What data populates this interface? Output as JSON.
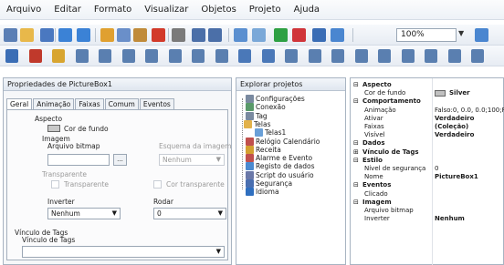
{
  "menu": [
    "Arquivo",
    "Editar",
    "Formato",
    "Visualizar",
    "Objetos",
    "Projeto",
    "Ajuda"
  ],
  "toolbar": {
    "zoom_value": "100%"
  },
  "properties_panel": {
    "title": "Propriedades de PictureBox1",
    "tabs": [
      "Geral",
      "Animação",
      "Faixas",
      "Comum",
      "Eventos"
    ],
    "aspect_label": "Aspecto",
    "bg_color_label": "Cor de fundo",
    "image_label": "Imagem",
    "bitmap_file_label": "Arquivo bitmap",
    "bitmap_browse": "...",
    "image_scheme_label": "Esquema da imagem",
    "image_scheme_value": "Nenhum",
    "transparent_label": "Transparente",
    "transparent_check_label": "Transparente",
    "transparent_color_label": "Cor transparente",
    "invert_label": "Inverter",
    "invert_value": "Nenhum",
    "rotate_label": "Rodar",
    "rotate_value": "0",
    "tag_link_group": "Vínculo de Tags",
    "tag_link_label": "Vínculo de Tags"
  },
  "project_explorer": {
    "title": "Explorar projetos",
    "items": [
      "Configurações",
      "Conexão",
      "Tag",
      "Telas",
      "Telas1",
      "Relógio Calendário",
      "Receita",
      "Alarme e Evento",
      "Registo de dados",
      "Script do usuário",
      "Segurança",
      "Idioma"
    ]
  },
  "property_grid": {
    "rows": [
      {
        "kind": "cat",
        "sign": "⊟",
        "key": "Aspecto"
      },
      {
        "kind": "prop",
        "key": "Cor de fundo",
        "value": "Silver",
        "bold": true,
        "swatch": "#c0c0c0"
      },
      {
        "kind": "cat",
        "sign": "⊟",
        "key": "Comportamento"
      },
      {
        "kind": "prop",
        "key": "Animação",
        "value": "Falso:0, 0.0, 0.0;100;Fals",
        "bold": false
      },
      {
        "kind": "prop",
        "key": "Ativar",
        "value": "Verdadeiro",
        "bold": true
      },
      {
        "kind": "prop",
        "key": "Faixas",
        "value": "(Coleção)",
        "bold": true
      },
      {
        "kind": "prop",
        "key": "Visível",
        "value": "Verdadeiro",
        "bold": true
      },
      {
        "kind": "cat",
        "sign": "⊟",
        "key": "Dados"
      },
      {
        "kind": "cat",
        "sign": "⊞",
        "key": "Vínculo de Tags"
      },
      {
        "kind": "cat",
        "sign": "⊟",
        "key": "Estilo"
      },
      {
        "kind": "prop",
        "key": "Nível de segurança",
        "value": "0",
        "bold": false
      },
      {
        "kind": "prop",
        "key": "Nome",
        "value": "PictureBox1",
        "bold": true
      },
      {
        "kind": "cat",
        "sign": "⊟",
        "key": "Eventos"
      },
      {
        "kind": "prop",
        "key": "Clicado",
        "value": "",
        "bold": false
      },
      {
        "kind": "cat",
        "sign": "⊟",
        "key": "Imagem"
      },
      {
        "kind": "prop",
        "key": "Arquivo bitmap",
        "value": "",
        "bold": false
      },
      {
        "kind": "prop",
        "key": "Inverter",
        "value": "Nenhum",
        "bold": true
      }
    ]
  },
  "icons": {
    "toolbar1": [
      "new-window-icon",
      "open-folder-icon",
      "save-icon",
      "undo-icon",
      "redo-icon",
      "cut-icon",
      "copy-icon",
      "paste-icon",
      "delete-icon",
      "find-icon",
      "grid-icon",
      "snap-grid-icon",
      "bar-chart-icon",
      "transfer-icon",
      "run-icon",
      "stop-icon",
      "download-icon",
      "zoom-fit-icon"
    ],
    "toolbar2": [
      "bring-front-icon",
      "send-back-icon",
      "lock-icon",
      "align-left-icon",
      "align-center-icon",
      "align-right-icon",
      "align-top-icon",
      "align-middle-icon",
      "align-bottom-icon",
      "rotate-icon",
      "group-icon",
      "ungroup-icon",
      "same-width-icon",
      "same-height-icon",
      "same-size-icon",
      "space-horizontal-icon",
      "space-vertical-icon",
      "center-horizontal-icon",
      "center-vertical-icon",
      "order-icon",
      "more-icon"
    ]
  }
}
